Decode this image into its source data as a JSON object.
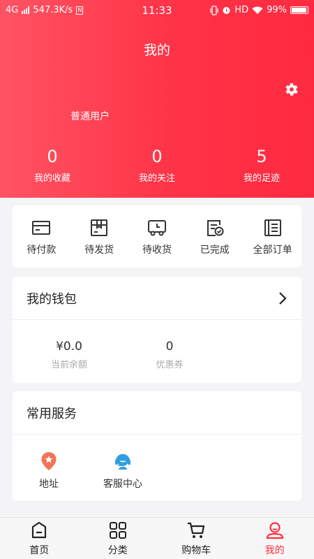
{
  "status_bar": {
    "network": "4G",
    "speed": "547.3K/s",
    "nfc": "N",
    "time": "11:33",
    "hd": "HD",
    "battery": "99%"
  },
  "header": {
    "title": "我的",
    "user_level": "普通用户",
    "stats": [
      {
        "value": "0",
        "label": "我的收藏"
      },
      {
        "value": "0",
        "label": "我的关注"
      },
      {
        "value": "5",
        "label": "我的足迹"
      }
    ]
  },
  "orders": [
    {
      "label": "待付款",
      "icon": "card-icon"
    },
    {
      "label": "待发货",
      "icon": "box-icon"
    },
    {
      "label": "待收货",
      "icon": "truck-icon"
    },
    {
      "label": "已完成",
      "icon": "done-icon"
    },
    {
      "label": "全部订单",
      "icon": "list-icon"
    }
  ],
  "wallet": {
    "title": "我的钱包",
    "balance": {
      "value": "¥0.0",
      "label": "当前余额"
    },
    "coupons": {
      "value": "0",
      "label": "优惠券"
    }
  },
  "services": {
    "title": "常用服务",
    "items": [
      {
        "label": "地址",
        "icon": "location-pin-icon",
        "color": "#f2755a"
      },
      {
        "label": "客服中心",
        "icon": "headset-icon",
        "color": "#2e9fdc"
      }
    ]
  },
  "tabbar": {
    "items": [
      {
        "label": "首页",
        "icon": "home-icon"
      },
      {
        "label": "分类",
        "icon": "grid-icon"
      },
      {
        "label": "购物车",
        "icon": "cart-icon"
      },
      {
        "label": "我的",
        "icon": "profile-icon"
      }
    ],
    "active_color": "#ff2d3f"
  },
  "colors": {
    "header_start": "#ff5363",
    "header_end": "#ff2a40"
  }
}
